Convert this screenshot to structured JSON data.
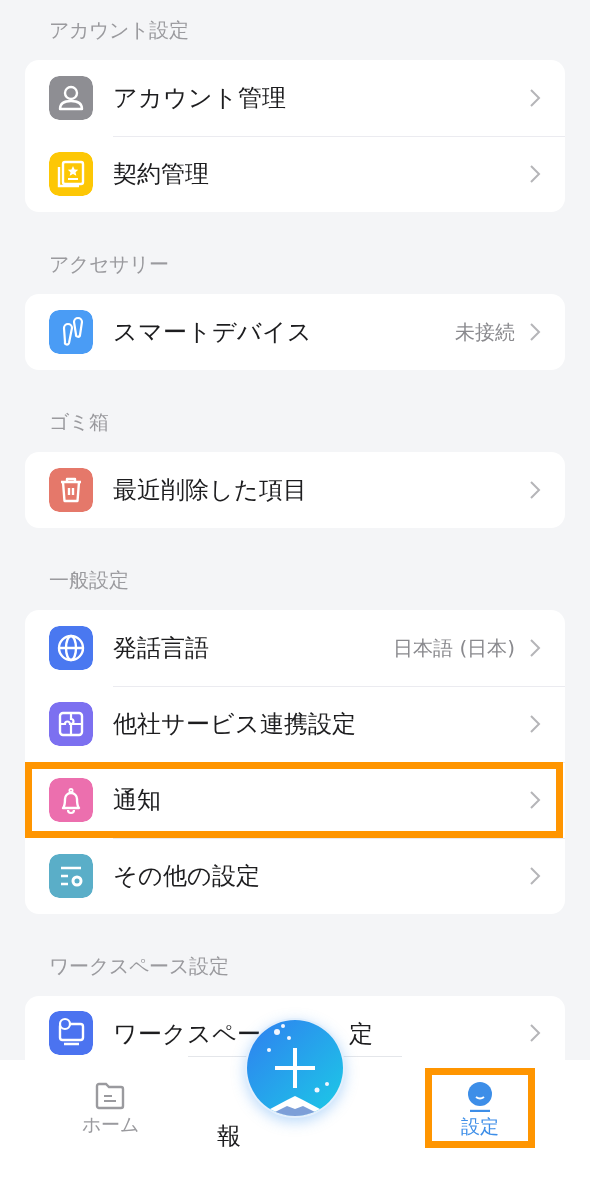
{
  "sections": [
    {
      "title": "アカウント設定",
      "items": [
        {
          "label": "アカウント管理",
          "color": "#8e8e93",
          "highlighted": false
        },
        {
          "label": "契約管理",
          "color": "#fdc705",
          "highlighted": false
        }
      ]
    },
    {
      "title": "アクセサリー",
      "items": [
        {
          "label": "スマートデバイス",
          "value": "未接続",
          "color": "#4a9cf5",
          "highlighted": false
        }
      ]
    },
    {
      "title": "ゴミ箱",
      "items": [
        {
          "label": "最近削除した項目",
          "color": "#e5786a",
          "highlighted": false
        }
      ]
    },
    {
      "title": "一般設定",
      "items": [
        {
          "label": "発話言語",
          "value": "日本語 (日本)",
          "color": "#4a78f0",
          "highlighted": false
        },
        {
          "label": "他社サービス連携設定",
          "color": "#7c70f0",
          "highlighted": false
        },
        {
          "label": "通知",
          "color": "#ec6fae",
          "highlighted": true
        },
        {
          "label": "その他の設定",
          "color": "#5aaec8",
          "highlighted": false
        }
      ]
    },
    {
      "title": "ワークスペース設定",
      "items": [
        {
          "label": "ワークスペー",
          "label_tail": "定",
          "color": "#4b73f0",
          "highlighted": false
        }
      ]
    }
  ],
  "tab_bar": {
    "tabs": [
      {
        "label": "ホーム",
        "selected": false,
        "highlighted": false
      },
      {
        "label": "報",
        "selected": false,
        "highlighted": false
      },
      {
        "label": "設定",
        "selected": true,
        "highlighted": true
      }
    ]
  }
}
